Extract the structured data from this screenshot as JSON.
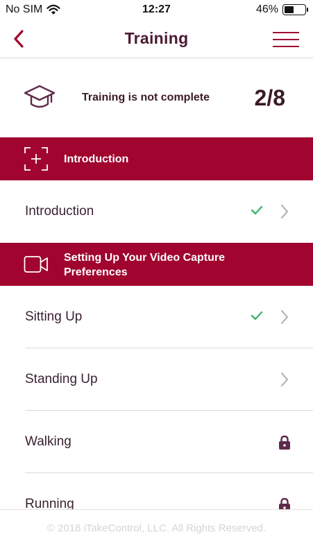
{
  "status_bar": {
    "carrier": "No SIM",
    "time": "12:27",
    "battery_percent_label": "46%",
    "battery_level": 0.46
  },
  "nav": {
    "title": "Training",
    "back_icon": "chevron-left-icon",
    "menu_icon": "hamburger-icon"
  },
  "summary": {
    "status_text": "Training is not complete",
    "count": "2/8",
    "icon": "graduation-cap-icon"
  },
  "sections": [
    {
      "title": "Introduction",
      "icon": "focus-plus-icon",
      "items": [
        {
          "label": "Introduction",
          "state": "completed"
        }
      ]
    },
    {
      "title": "Setting Up Your Video Capture Preferences",
      "icon": "video-camera-icon",
      "items": [
        {
          "label": "Sitting Up",
          "state": "completed"
        },
        {
          "label": "Standing Up",
          "state": "available"
        },
        {
          "label": "Walking",
          "state": "locked"
        },
        {
          "label": "Running",
          "state": "locked"
        }
      ]
    }
  ],
  "footer": {
    "copyright": "© 2018 iTakeControl, LLC. All Rights Reserved."
  },
  "colors": {
    "accent": "#a0042f",
    "title_text": "#4a1a30",
    "check": "#3cb56b",
    "lock": "#5e2a4a",
    "chevron": "#b9b3b7"
  }
}
